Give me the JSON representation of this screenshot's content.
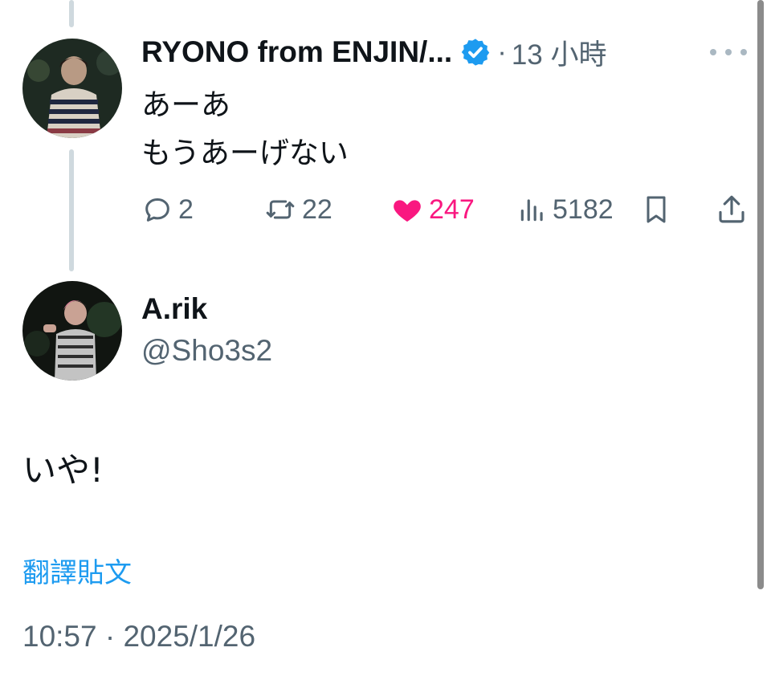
{
  "parent_tweet": {
    "author_name": "RYONO from ENJIN/...",
    "separator": "·",
    "time": "13 小時",
    "lines": [
      "あーあ",
      "もうあーげない"
    ],
    "actions": {
      "replies": "2",
      "reposts": "22",
      "likes": "247",
      "views": "5182"
    },
    "liked": true
  },
  "reply_tweet": {
    "author_name": "A.rik",
    "handle": "@Sho3s2",
    "text": "いや!",
    "translate_label": "翻譯貼文",
    "timestamp": "10:57 · 2025/1/26"
  },
  "colors": {
    "text_primary": "#0f1419",
    "text_secondary": "#536471",
    "like_pink": "#f91880",
    "link_blue": "#1d9bf0",
    "verified_blue": "#1d9bf0",
    "thread_line": "#cfd9de"
  },
  "icons": {
    "verified": "verified-badge-icon",
    "more": "more-dots-icon",
    "reply": "reply-bubble-icon",
    "repost": "repost-icon",
    "like": "heart-filled-icon",
    "views": "views-bar-chart-icon",
    "bookmark": "bookmark-icon",
    "share": "share-upload-icon"
  }
}
